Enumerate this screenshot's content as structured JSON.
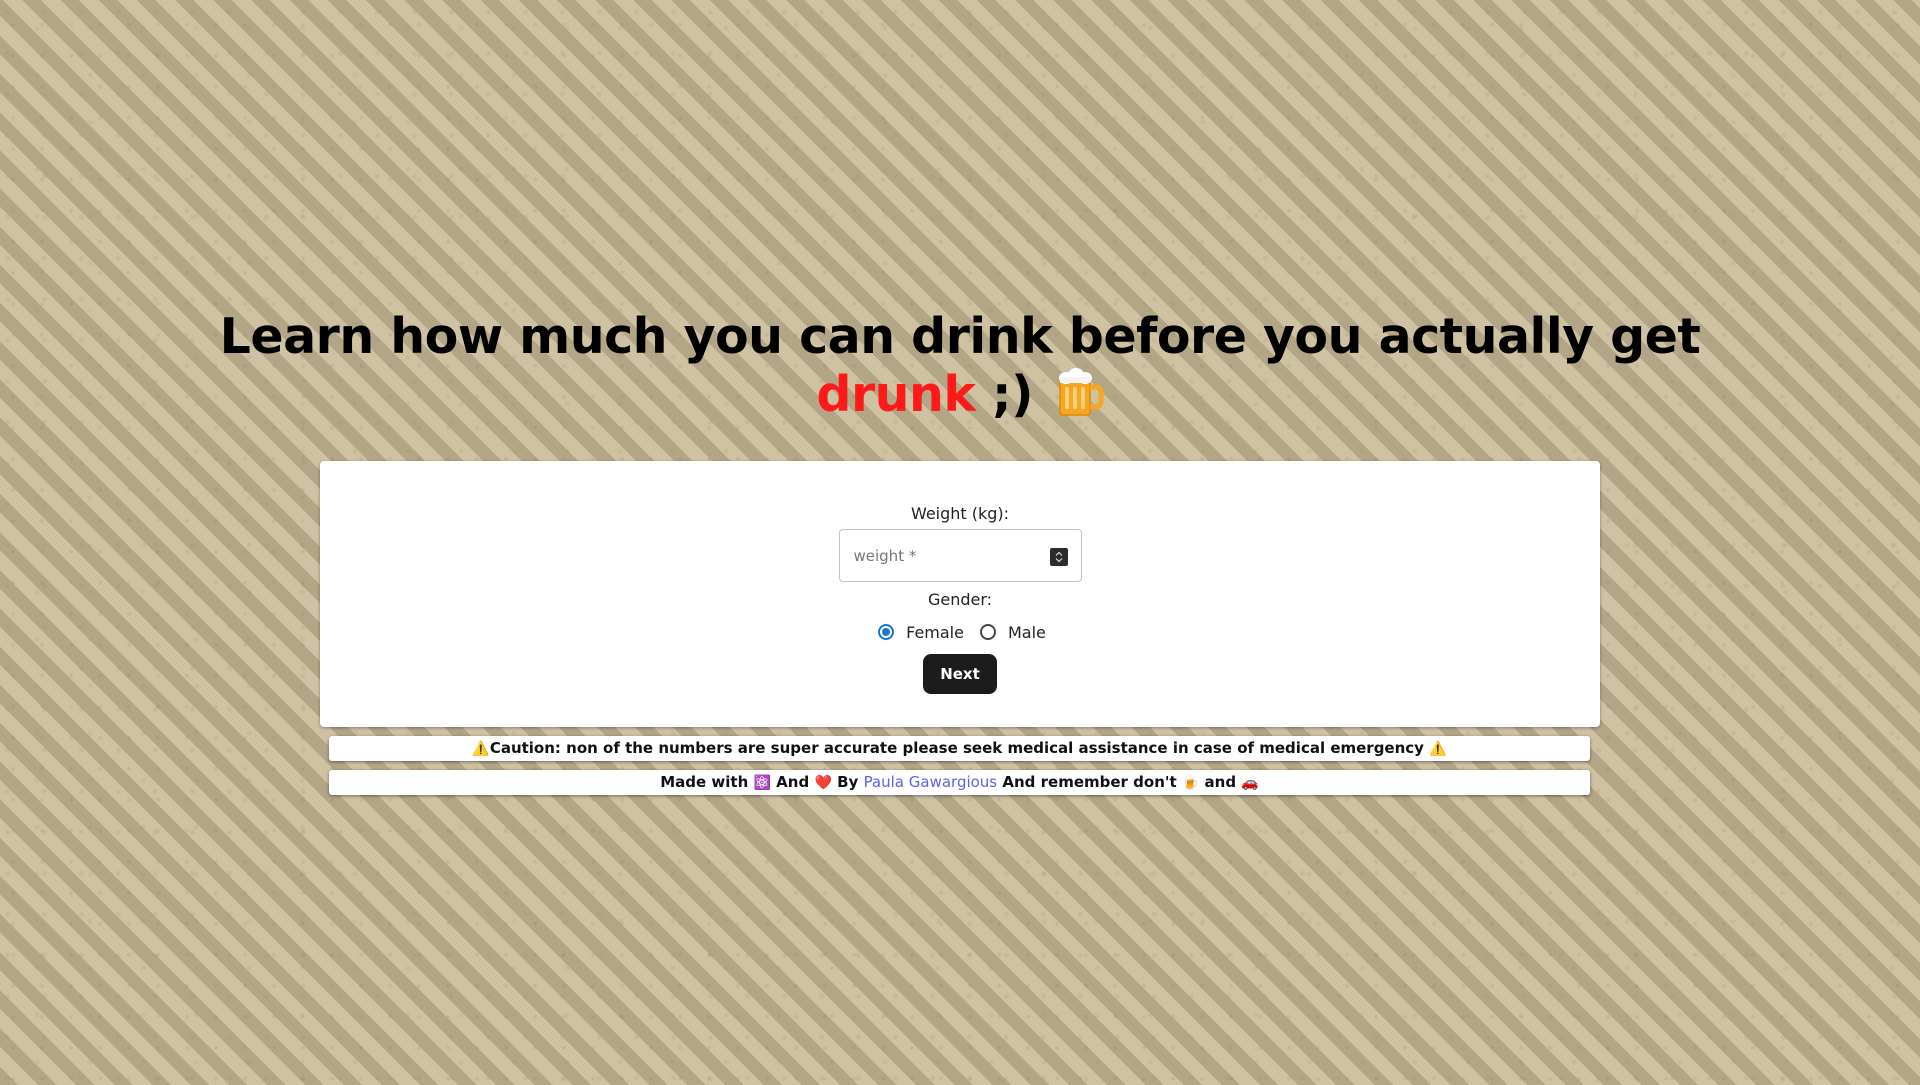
{
  "headline": {
    "line1": "Learn how much you can drink before you actually get",
    "emph": "drunk",
    "wink": ";)",
    "icon": "beer-mug-icon"
  },
  "form": {
    "weight_label": "Weight (kg):",
    "weight_placeholder": "weight *",
    "weight_value": "",
    "gender_label": "Gender:",
    "gender_options": [
      "Female",
      "Male"
    ],
    "gender_selected": "Female",
    "next_label": "Next"
  },
  "caution": {
    "prefix_icon": "⚠️",
    "text": "Caution: non of the numbers are super accurate please seek medical assistance in case of medical emergency",
    "suffix_icon": "⚠️"
  },
  "credits": {
    "made_with": "Made with",
    "react_icon": "⚛️",
    "and1": "And",
    "heart_icon": "❤️",
    "by": "By",
    "author": "Paula Gawargious",
    "remember": "And remember don't",
    "beer_icon": "🍺",
    "and2": "and",
    "car_icon": "🚗"
  },
  "colors": {
    "accent_red": "#ff1a1a",
    "radio_blue": "#1976d2",
    "link_blue": "#5b62e8",
    "button_dark": "#1c1c1c"
  }
}
